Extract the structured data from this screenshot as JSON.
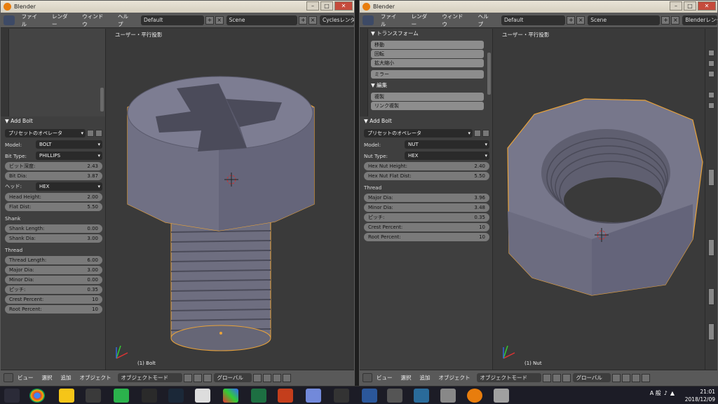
{
  "window_title": "Blender",
  "menu": {
    "file": "ファイル",
    "render": "レンダー",
    "window": "ウィンドウ",
    "help": "ヘルプ"
  },
  "left": {
    "layout": "Default",
    "scene": "Scene",
    "engine": "Cyclesレンダ",
    "viewport_title": "ユーザー・平行投影",
    "viewport_footer": "(1) Bolt",
    "panel_title": "Add Bolt",
    "preset_label": "プリセットのオペレータ",
    "model_label": "Model:",
    "model_value": "BOLT",
    "bit_type_label": "Bit Type:",
    "bit_type_value": "PHILLIPS",
    "bit_depth_label": "ビット深度:",
    "bit_depth_value": "2.43",
    "bit_dia_label": "Bit Dia:",
    "bit_dia_value": "3.87",
    "head_label": "ヘッド:",
    "head_value": "HEX",
    "head_height_label": "Head Height:",
    "head_height_value": "2.00",
    "flat_dist_label": "Flat Dist:",
    "flat_dist_value": "5.50",
    "shank_heading": "Shank",
    "shank_length_label": "Shank Length:",
    "shank_length_value": "0.00",
    "shank_dia_label": "Shank Dia:",
    "shank_dia_value": "3.00",
    "thread_heading": "Thread",
    "thread_length_label": "Thread Length:",
    "thread_length_value": "6.00",
    "major_dia_label": "Major Dia:",
    "major_dia_value": "3.00",
    "minor_dia_label": "Minor Dia:",
    "minor_dia_value": "0.00",
    "pitch_label": "ピッチ:",
    "pitch_value": "0.35",
    "crest_label": "Crest Percent:",
    "crest_value": "10",
    "root_label": "Root Percent:",
    "root_value": "10"
  },
  "right": {
    "layout": "Default",
    "scene": "Scene",
    "engine": "Blenderレンダ",
    "viewport_title": "ユーザー・平行投影",
    "viewport_footer": "(1) Nut",
    "transform_heading": "トランスフォーム",
    "move": "移動",
    "rotate": "回転",
    "scale": "拡大縮小",
    "mirror": "ミラー",
    "edit_heading": "編集",
    "duplicate": "複製",
    "link_duplicate": "リンク複製",
    "panel_title": "Add Bolt",
    "preset_label": "プリセットのオペレータ",
    "model_label": "Model:",
    "model_value": "NUT",
    "nut_type_label": "Nut Type:",
    "nut_type_value": "HEX",
    "hex_nut_height_label": "Hex Nut Height:",
    "hex_nut_height_value": "2.40",
    "hex_nut_flat_label": "Hex Nut Flat Dist:",
    "hex_nut_flat_value": "5.50",
    "thread_heading": "Thread",
    "major_dia_label": "Major Dia:",
    "major_dia_value": "3.96",
    "minor_dia_label": "Minor Dia:",
    "minor_dia_value": "3.48",
    "pitch_label": "ピッチ:",
    "pitch_value": "0.35",
    "crest_label": "Crest Percent:",
    "crest_value": "10",
    "root_label": "Root Percent:",
    "root_value": "10"
  },
  "footer": {
    "view": "ビュー",
    "select": "選択",
    "add": "追加",
    "object": "オブジェクト",
    "mode": "オブジェクトモード",
    "global": "グローバル"
  },
  "taskbar": {
    "time": "21:01",
    "date": "2018/12/09",
    "ime": "A 般"
  }
}
